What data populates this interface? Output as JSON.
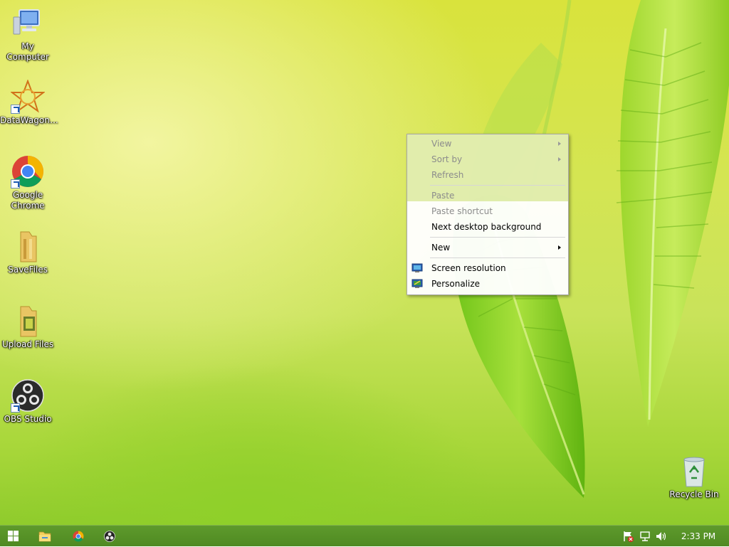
{
  "desktop": {
    "icons": [
      {
        "label": "My Computer",
        "icon": "computer-icon",
        "shortcut": false
      },
      {
        "label": "DataWagon…",
        "icon": "datawagon-icon",
        "shortcut": true
      },
      {
        "label": "Google Chrome",
        "icon": "chrome-icon",
        "shortcut": true
      },
      {
        "label": "SaveFiles",
        "icon": "folder-icon",
        "shortcut": false
      },
      {
        "label": "Upload Files",
        "icon": "folder-icon",
        "shortcut": false
      },
      {
        "label": "OBS Studio",
        "icon": "obs-icon",
        "shortcut": true
      }
    ],
    "recycle_bin": {
      "label": "Recycle Bin",
      "icon": "recycle-bin-icon"
    }
  },
  "context_menu": {
    "items": [
      {
        "label": "View",
        "enabled": false,
        "submenu": true
      },
      {
        "label": "Sort by",
        "enabled": false,
        "submenu": true
      },
      {
        "label": "Refresh",
        "enabled": false
      },
      {
        "label": "Paste",
        "enabled": false
      },
      {
        "label": "Paste shortcut",
        "enabled": false
      },
      {
        "label": "Next desktop background",
        "enabled": true
      },
      {
        "label": "New",
        "enabled": true,
        "submenu": true
      },
      {
        "label": "Screen resolution",
        "enabled": true,
        "icon": "screen-resolution-icon"
      },
      {
        "label": "Personalize",
        "enabled": true,
        "icon": "personalize-icon"
      }
    ]
  },
  "taskbar": {
    "buttons": [
      {
        "name": "start-button",
        "icon": "windows-logo-icon"
      },
      {
        "name": "file-explorer-button",
        "icon": "folder-icon"
      },
      {
        "name": "chrome-taskbar-button",
        "icon": "chrome-icon"
      },
      {
        "name": "obs-taskbar-button",
        "icon": "obs-icon"
      }
    ],
    "tray_icons": [
      "action-center-flag-icon",
      "network-icon",
      "volume-icon"
    ],
    "clock": "2:33 PM"
  },
  "colors": {
    "wallpaper_yellow": "#d9e33c",
    "wallpaper_green": "#8fcb2c",
    "taskbar": "#558f26",
    "menu_disabled_text": "#8c8c8c"
  }
}
